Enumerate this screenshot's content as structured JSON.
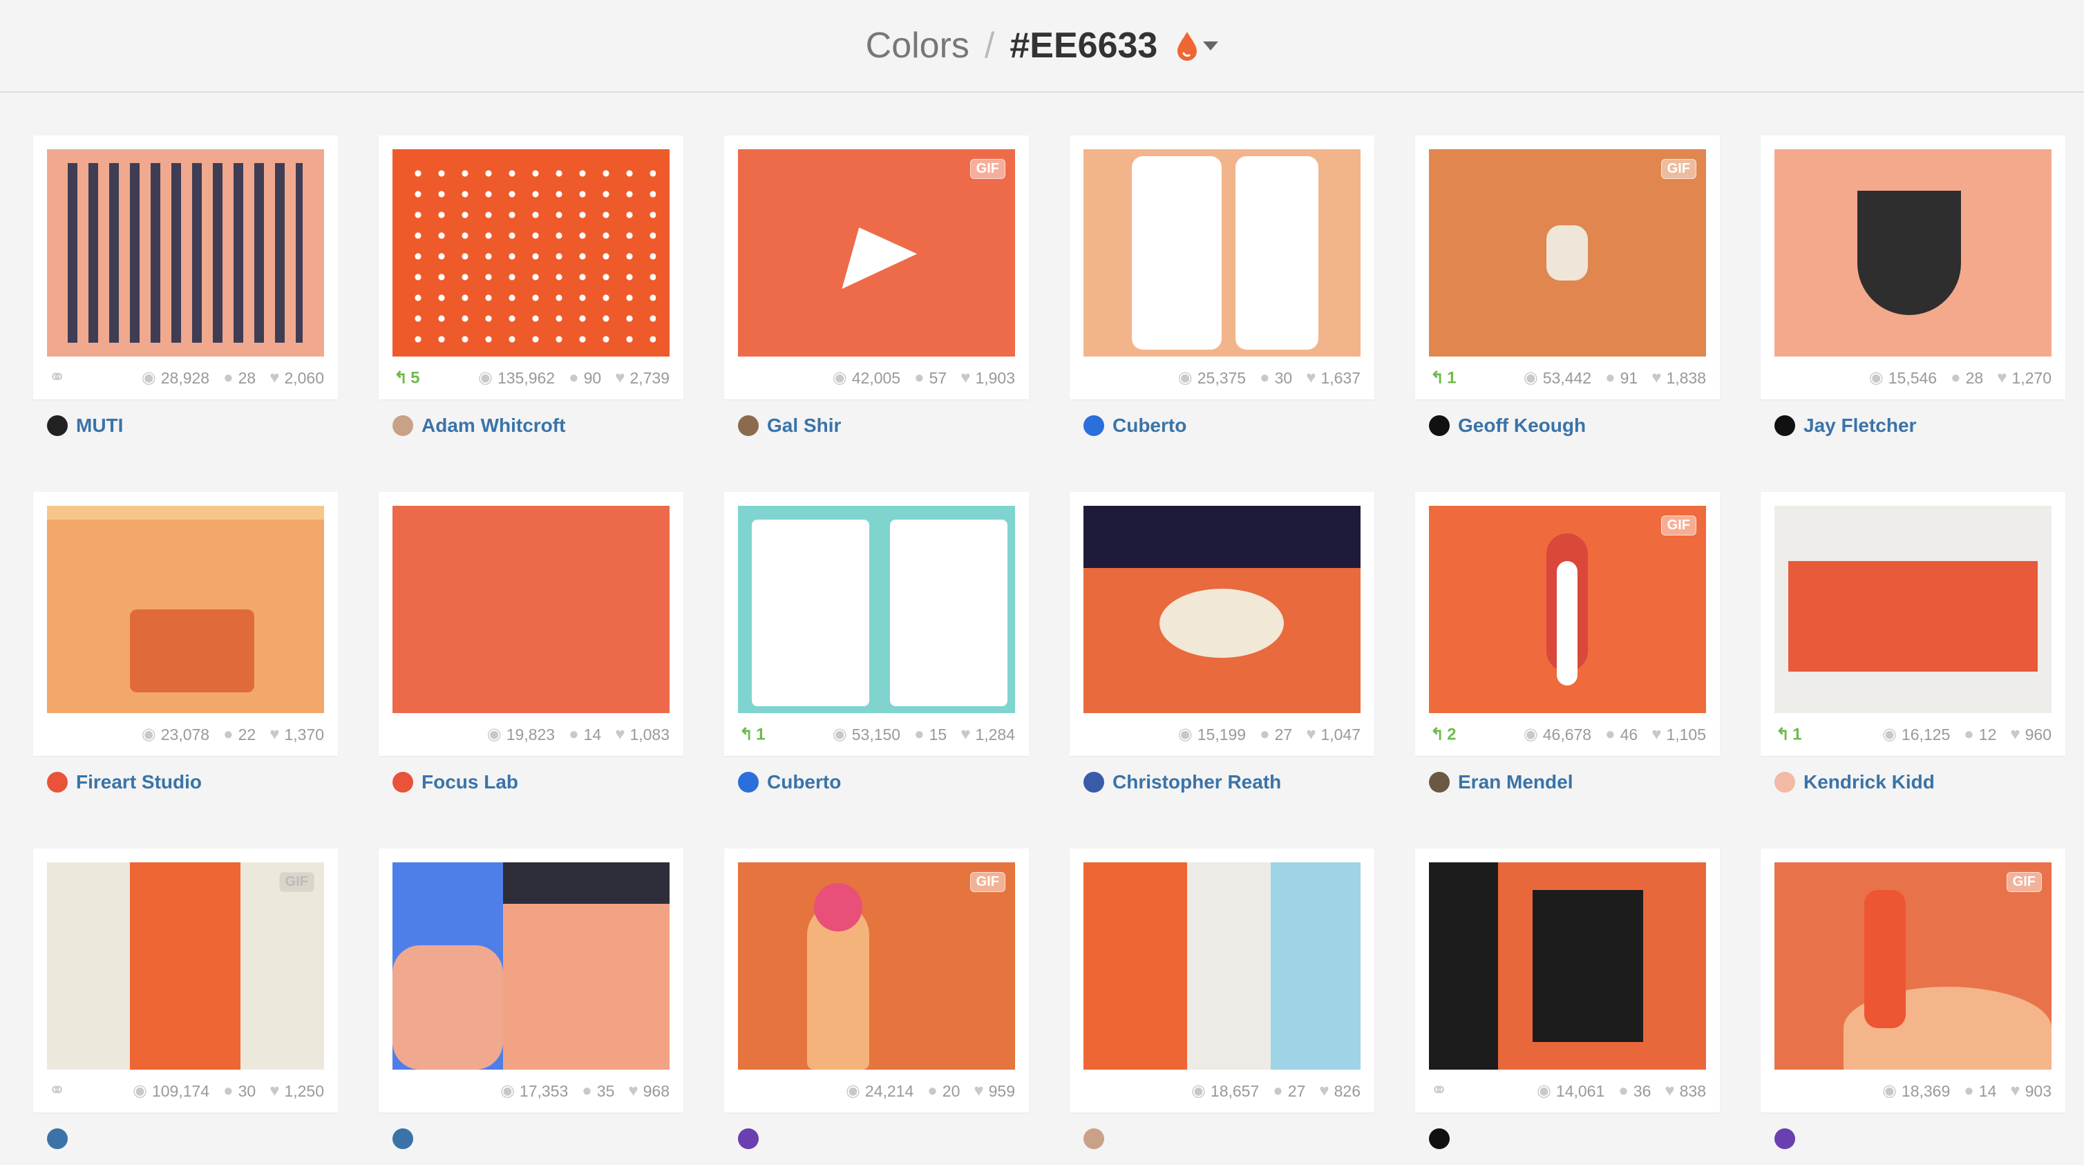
{
  "header": {
    "parent": "Colors",
    "separator": "/",
    "current": "#EE6633",
    "accent": "#EE6633"
  },
  "shots": [
    {
      "author": "MUTI",
      "views": "28,928",
      "comments": "28",
      "likes": "2,060",
      "left": "link",
      "rebounds": "",
      "gif": false,
      "bg": "#f0a98f",
      "avatar": "#222"
    },
    {
      "author": "Adam Whitcroft",
      "views": "135,962",
      "comments": "90",
      "likes": "2,739",
      "left": "rebound",
      "rebounds": "5",
      "gif": false,
      "bg": "#ee5a2a",
      "avatar": "#c9a188"
    },
    {
      "author": "Gal Shir",
      "views": "42,005",
      "comments": "57",
      "likes": "1,903",
      "left": "",
      "rebounds": "",
      "gif": true,
      "bg": "#ee6b4a",
      "avatar": "#8b6b4e"
    },
    {
      "author": "Cuberto",
      "views": "25,375",
      "comments": "30",
      "likes": "1,637",
      "left": "",
      "rebounds": "",
      "gif": false,
      "bg": "#f2b48a",
      "avatar": "#2a6fdb"
    },
    {
      "author": "Geoff Keough",
      "views": "53,442",
      "comments": "91",
      "likes": "1,838",
      "left": "rebound",
      "rebounds": "1",
      "gif": true,
      "bg": "#e0864e",
      "avatar": "#111"
    },
    {
      "author": "Jay Fletcher",
      "views": "15,546",
      "comments": "28",
      "likes": "1,270",
      "left": "",
      "rebounds": "",
      "gif": false,
      "bg": "#f4a98c",
      "avatar": "#111"
    },
    {
      "author": "Fireart Studio",
      "views": "23,078",
      "comments": "22",
      "likes": "1,370",
      "left": "",
      "rebounds": "",
      "gif": false,
      "bg": "#f2a86a",
      "avatar": "#e8533a"
    },
    {
      "author": "Focus Lab",
      "views": "19,823",
      "comments": "14",
      "likes": "1,083",
      "left": "",
      "rebounds": "",
      "gif": false,
      "bg": "#ec6a4a",
      "avatar": "#e8533a"
    },
    {
      "author": "Cuberto",
      "views": "53,150",
      "comments": "15",
      "likes": "1,284",
      "left": "rebound",
      "rebounds": "1",
      "gif": false,
      "bg": "#7fd4cf",
      "avatar": "#2a6fdb"
    },
    {
      "author": "Christopher Reath",
      "views": "15,199",
      "comments": "27",
      "likes": "1,047",
      "left": "",
      "rebounds": "",
      "gif": false,
      "bg": "#e86a3d",
      "avatar": "#3a5ba8"
    },
    {
      "author": "Eran Mendel",
      "views": "46,678",
      "comments": "46",
      "likes": "1,105",
      "left": "rebound",
      "rebounds": "2",
      "gif": true,
      "bg": "#ef6a3c",
      "avatar": "#6b5744"
    },
    {
      "author": "Kendrick Kidd",
      "views": "16,125",
      "comments": "12",
      "likes": "960",
      "left": "rebound",
      "rebounds": "1",
      "gif": false,
      "bg": "#efedea",
      "avatar": "#f2b9a6"
    },
    {
      "author": "",
      "views": "109,174",
      "comments": "30",
      "likes": "1,250",
      "left": "link",
      "rebounds": "",
      "gif": true,
      "bg": "#ece8dc",
      "avatar": "#3a73a8"
    },
    {
      "author": "",
      "views": "17,353",
      "comments": "35",
      "likes": "968",
      "left": "",
      "rebounds": "",
      "gif": true,
      "bg": "#4e7fe9",
      "avatar": "#3a73a8"
    },
    {
      "author": "",
      "views": "24,214",
      "comments": "20",
      "likes": "959",
      "left": "",
      "rebounds": "",
      "gif": true,
      "bg": "#e6743e",
      "avatar": "#6a3fb0"
    },
    {
      "author": "",
      "views": "18,657",
      "comments": "27",
      "likes": "826",
      "left": "",
      "rebounds": "",
      "gif": false,
      "bg": "#ecebe6",
      "avatar": "#c9a188"
    },
    {
      "author": "",
      "views": "14,061",
      "comments": "36",
      "likes": "838",
      "left": "link",
      "rebounds": "",
      "gif": false,
      "bg": "#e8683c",
      "avatar": "#111"
    },
    {
      "author": "",
      "views": "18,369",
      "comments": "14",
      "likes": "903",
      "left": "",
      "rebounds": "",
      "gif": true,
      "bg": "#e8734a",
      "avatar": "#6a3fb0"
    }
  ]
}
